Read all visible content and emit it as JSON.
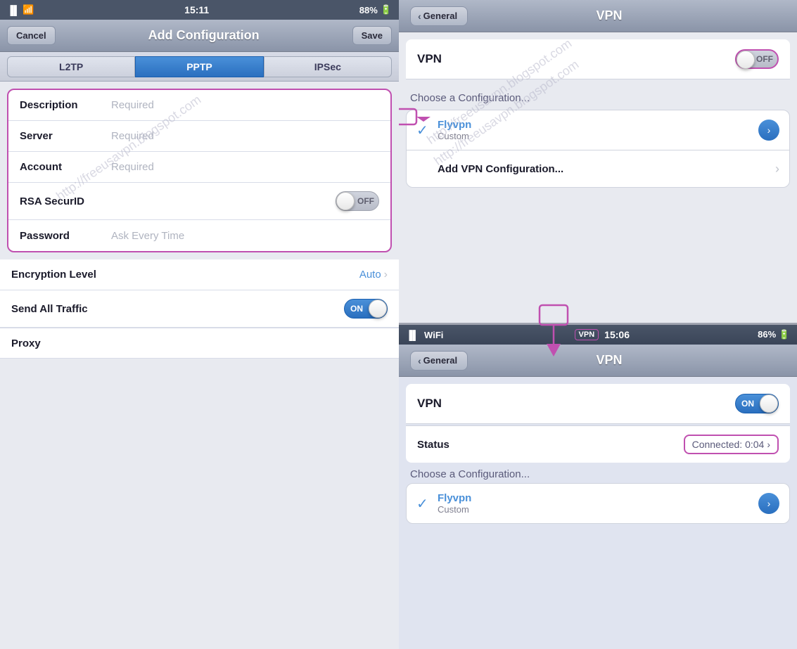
{
  "left": {
    "statusBar": {
      "signal": "●●●",
      "wifi": "WiFi",
      "time": "15:11",
      "battery": "88%"
    },
    "navBar": {
      "cancelLabel": "Cancel",
      "title": "Add Configuration",
      "saveLabel": "Save"
    },
    "tabs": [
      {
        "id": "l2tp",
        "label": "L2TP",
        "active": false
      },
      {
        "id": "pptp",
        "label": "PPTP",
        "active": true
      },
      {
        "id": "ipsec",
        "label": "IPSec",
        "active": false
      }
    ],
    "formFields": [
      {
        "label": "Description",
        "placeholder": "Required",
        "type": "text"
      },
      {
        "label": "Server",
        "placeholder": "Required",
        "type": "text"
      },
      {
        "label": "Account",
        "placeholder": "Required",
        "type": "text"
      },
      {
        "label": "RSA SecurID",
        "placeholder": "",
        "type": "toggle",
        "toggleState": "off",
        "toggleLabel": "OFF"
      },
      {
        "label": "Password",
        "placeholder": "Ask Every Time",
        "type": "text"
      }
    ],
    "plainRows": [
      {
        "label": "Encryption Level",
        "value": "Auto",
        "hasChevron": true
      },
      {
        "label": "Send All Traffic",
        "value": "",
        "type": "toggle",
        "toggleState": "on",
        "toggleLabel": "ON"
      }
    ],
    "proxyLabel": "Proxy",
    "watermark": "http://freeusavpn.blogspot.com"
  },
  "rightTop": {
    "navBar": {
      "backLabel": "General",
      "title": "VPN"
    },
    "vpnRow": {
      "label": "VPN",
      "toggleState": "off",
      "toggleLabel": "OFF"
    },
    "configHeader": "Choose a Configuration...",
    "configs": [
      {
        "checked": true,
        "name": "Flyvpn",
        "sub": "Custom",
        "hasDetail": true
      },
      {
        "checked": false,
        "name": "Add VPN Configuration...",
        "sub": "",
        "hasDetail": false,
        "hasChevron": true
      }
    ],
    "watermark": "http://freeusavpn.blogspot.com"
  },
  "rightBottom": {
    "statusBar": {
      "signal": "●●",
      "wifi": "WiFi",
      "vpnBadge": "VPN",
      "time": "15:06",
      "battery": "86%"
    },
    "navBar": {
      "backLabel": "General",
      "title": "VPN"
    },
    "vpnRow": {
      "label": "VPN",
      "toggleState": "on",
      "toggleLabel": "ON"
    },
    "statusRow": {
      "label": "Status",
      "value": "Connected: 0:04",
      "hasChevron": true
    },
    "configHeader": "Choose a Configuration...",
    "configs": [
      {
        "checked": true,
        "name": "Flyvpn",
        "sub": "Custom",
        "hasDetail": true
      }
    ],
    "watermark": "http://freeusavpn.blogspot.com"
  },
  "annotations": {
    "arrowRight": "→",
    "arrowDown": "↓"
  }
}
